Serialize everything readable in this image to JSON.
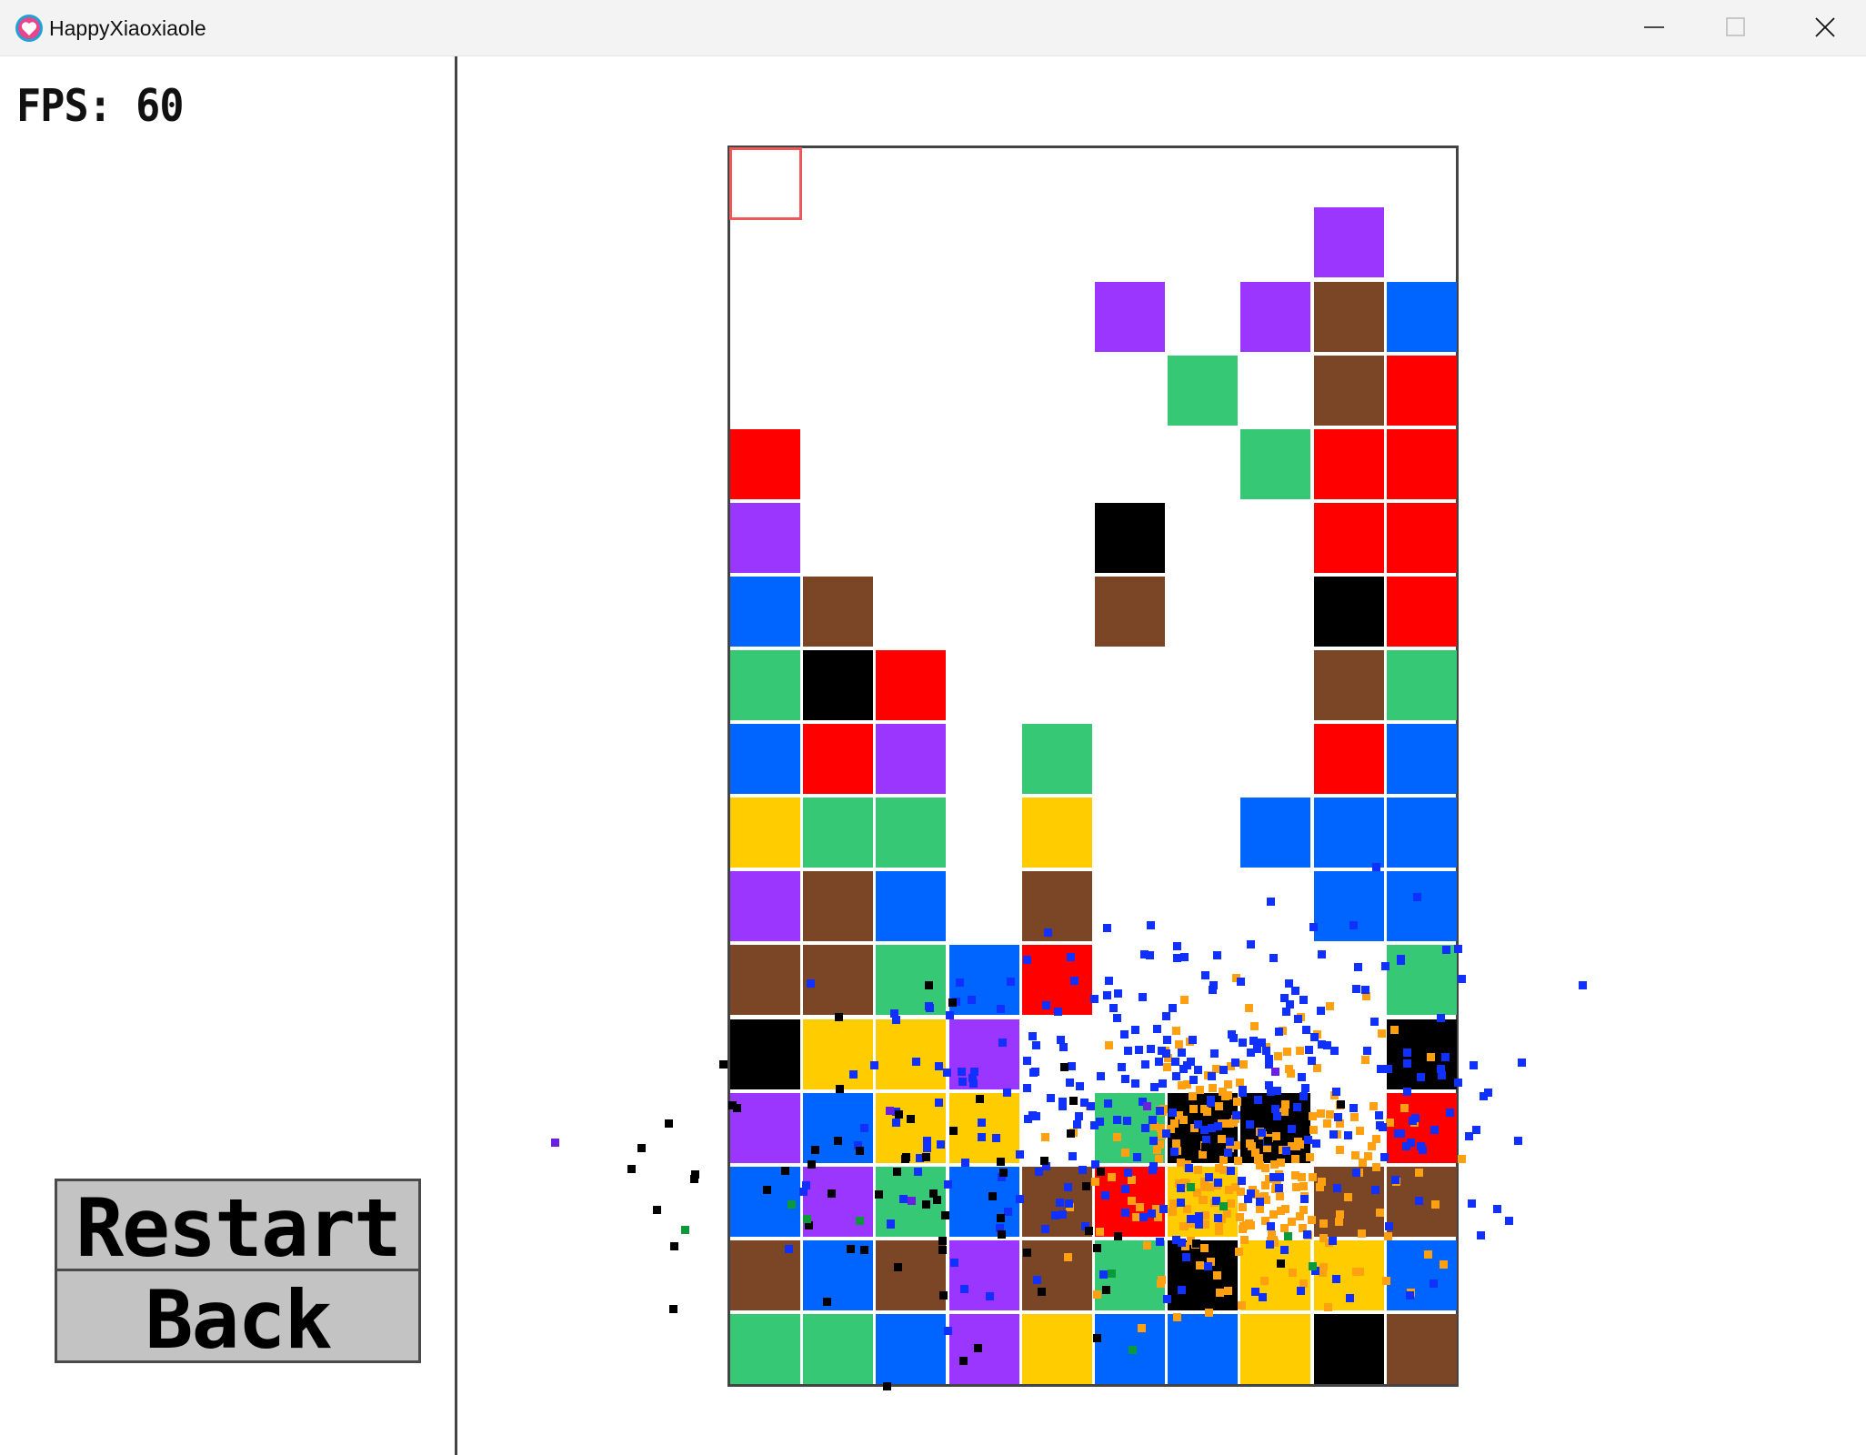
{
  "window": {
    "title": "HappyXiaoxiaole"
  },
  "hud": {
    "fps_text": "FPS: 60"
  },
  "buttons": {
    "restart_label": "Restart",
    "back_label": "Back"
  },
  "colors": {
    "R": "#ff0000",
    "P": "#9a36ff",
    "B": "#0064ff",
    "G": "#36c874",
    "Y": "#ffcc00",
    "N": "#7a4625",
    "K": "#000000",
    "particle_blue": "#1030ff",
    "particle_orange": "#ffa010",
    "particle_black": "#000000",
    "particle_green": "#0a9a3a",
    "particle_purple": "#6a20e0"
  },
  "board": {
    "legend": {
      "R": "red",
      "P": "purple",
      "B": "blue",
      "G": "green",
      "Y": "yellow",
      "N": "brown",
      "K": "black"
    },
    "columns": [
      [
        "G",
        "N",
        "B",
        "P",
        "K",
        "N",
        "P",
        "Y",
        "B",
        "G",
        "B",
        "P",
        "R"
      ],
      [
        "G",
        "B",
        "P",
        "B",
        "Y",
        "N",
        "N",
        "G",
        "R",
        "K",
        "N"
      ],
      [
        "B",
        "N",
        "G",
        "Y",
        "Y",
        "G",
        "B",
        "G",
        "P",
        "R"
      ],
      [
        "P",
        "P",
        "B",
        "Y",
        "P",
        "B"
      ],
      [
        "Y",
        "N",
        "N",
        "",
        "",
        "R",
        "N",
        "Y",
        "G"
      ],
      [
        "B",
        "G",
        "R",
        "G",
        "",
        "",
        "",
        "",
        "",
        "",
        "N",
        "K",
        "",
        "",
        "P"
      ],
      [
        "B",
        "K",
        "Y",
        "K",
        "",
        "",
        "",
        "",
        "",
        "",
        "",
        "",
        "",
        "G"
      ],
      [
        "Y",
        "Y",
        "",
        "K",
        "",
        "",
        "",
        "B",
        "",
        "",
        "",
        "",
        "G",
        "",
        "P"
      ],
      [
        "K",
        "Y",
        "N",
        "",
        "",
        "",
        "B",
        "B",
        "R",
        "N",
        "K",
        "R",
        "R",
        "N",
        "N",
        "P"
      ],
      [
        "N",
        "B",
        "N",
        "R",
        "K",
        "G",
        "B",
        "B",
        "B",
        "G",
        "R",
        "R",
        "R",
        "R",
        "B"
      ]
    ]
  }
}
